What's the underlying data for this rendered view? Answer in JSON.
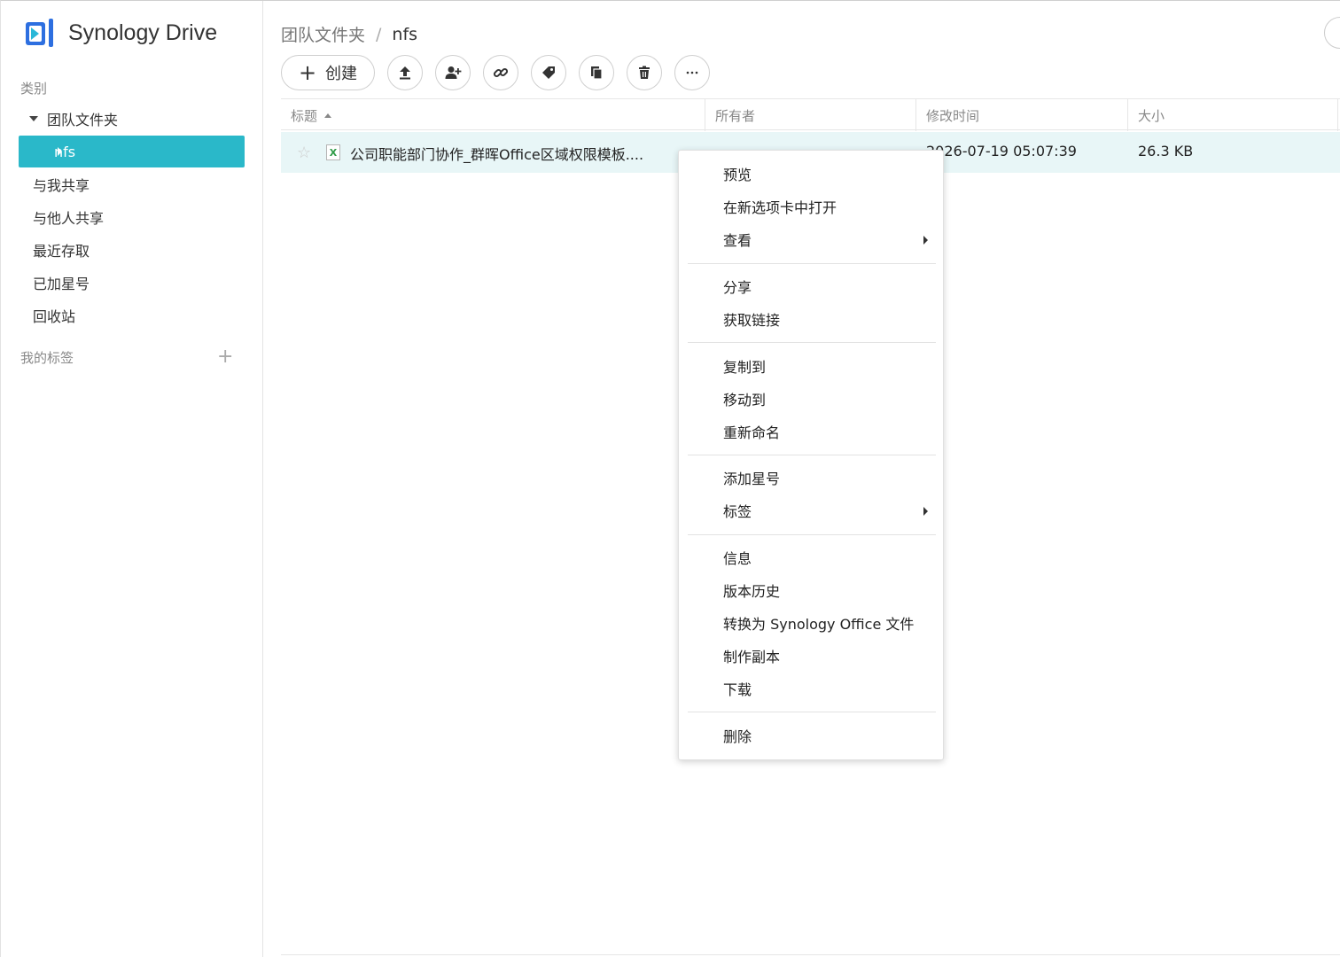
{
  "app": {
    "name": "Synology Drive"
  },
  "sidebar": {
    "category_label": "类别",
    "items": [
      {
        "label": "团队文件夹"
      },
      {
        "label": "nfs"
      },
      {
        "label": "与我共享"
      },
      {
        "label": "与他人共享"
      },
      {
        "label": "最近存取"
      },
      {
        "label": "已加星号"
      },
      {
        "label": "回收站"
      }
    ],
    "tags_label": "我的标签",
    "add_tag_symbol": "+"
  },
  "breadcrumb": {
    "parent": "团队文件夹",
    "separator": "/",
    "current": "nfs"
  },
  "toolbar": {
    "create_label": "创建",
    "create_symbol": "+"
  },
  "table": {
    "columns": [
      "标题",
      "所有者",
      "修改时间",
      "大小"
    ],
    "rows": [
      {
        "name": "公司职能部门协作_群晖Office区域权限模板....",
        "owner": "",
        "modified": "2026-07-19 05:07:39",
        "size": "26.3 KB",
        "file_icon": "X"
      }
    ]
  },
  "context_menu": {
    "items": [
      "预览",
      "在新选项卡中打开",
      "查看",
      "分享",
      "获取链接",
      "复制到",
      "移动到",
      "重新命名",
      "添加星号",
      "标签",
      "信息",
      "版本历史",
      "转换为 Synology Office 文件",
      "制作副本",
      "下载",
      "删除"
    ]
  },
  "colors": {
    "accent": "#2ab8c9",
    "selected_row": "#e8f6f7",
    "logo_blue": "#2d6fe0"
  }
}
